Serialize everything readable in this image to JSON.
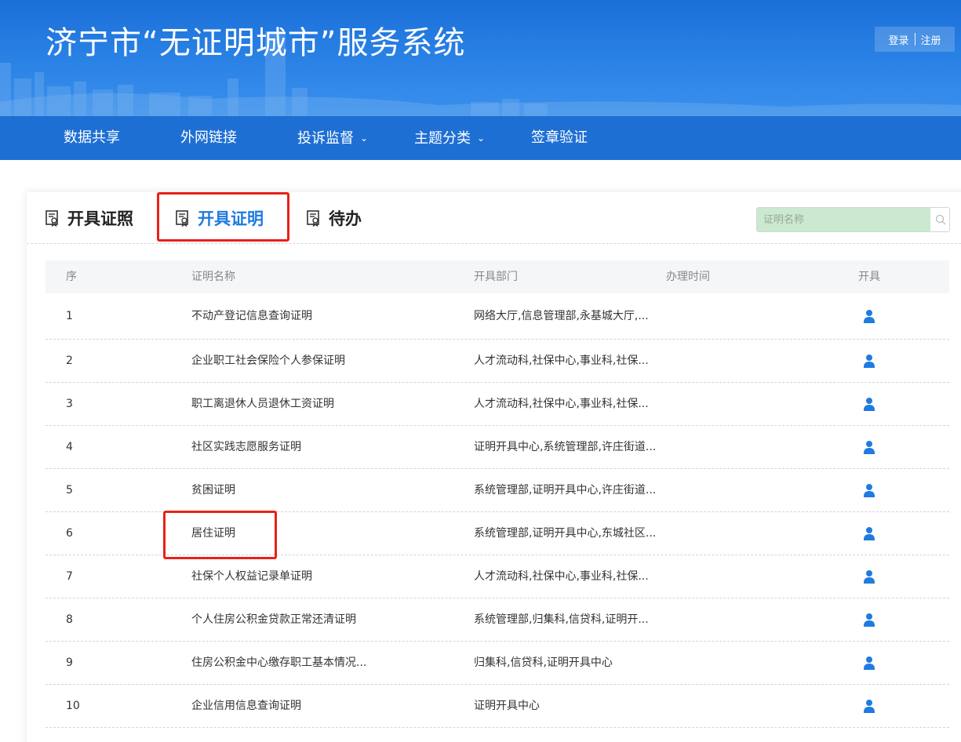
{
  "header": {
    "title": "济宁市“无证明城市”服务系统",
    "login_label": "登录",
    "register_label": "注册"
  },
  "nav": {
    "items": [
      {
        "label": "数据共享",
        "has_dropdown": false
      },
      {
        "label": "外网链接",
        "has_dropdown": false
      },
      {
        "label": "投诉监督",
        "has_dropdown": true
      },
      {
        "label": "主题分类",
        "has_dropdown": true
      },
      {
        "label": "签章验证",
        "has_dropdown": false
      }
    ]
  },
  "tabs": [
    {
      "label": "开具证照",
      "active": false
    },
    {
      "label": "开具证明",
      "active": true
    },
    {
      "label": "待办",
      "active": false
    }
  ],
  "search": {
    "placeholder": "证明名称",
    "value": ""
  },
  "table": {
    "columns": [
      "序",
      "证明名称",
      "开具部门",
      "办理时间",
      "开具"
    ],
    "rows": [
      {
        "index": "1",
        "name": "不动产登记信息查询证明",
        "department": "网络大厅,信息管理部,永基城大厅,...",
        "time": ""
      },
      {
        "index": "2",
        "name": "企业职工社会保险个人参保证明",
        "department": "人才流动科,社保中心,事业科,社保...",
        "time": ""
      },
      {
        "index": "3",
        "name": "职工离退休人员退休工资证明",
        "department": "人才流动科,社保中心,事业科,社保...",
        "time": ""
      },
      {
        "index": "4",
        "name": "社区实践志愿服务证明",
        "department": "证明开具中心,系统管理部,许庄街道...",
        "time": ""
      },
      {
        "index": "5",
        "name": "贫困证明",
        "department": "系统管理部,证明开具中心,许庄街道...",
        "time": ""
      },
      {
        "index": "6",
        "name": "居住证明",
        "department": "系统管理部,证明开具中心,东城社区...",
        "time": ""
      },
      {
        "index": "7",
        "name": "社保个人权益记录单证明",
        "department": "人才流动科,社保中心,事业科,社保...",
        "time": ""
      },
      {
        "index": "8",
        "name": "个人住房公积金贷款正常还清证明",
        "department": "系统管理部,归集科,信贷科,证明开...",
        "time": ""
      },
      {
        "index": "9",
        "name": "住房公积金中心缴存职工基本情况...",
        "department": "归集科,信贷科,证明开具中心",
        "time": ""
      },
      {
        "index": "10",
        "name": "企业信用信息查询证明",
        "department": "证明开具中心",
        "time": ""
      }
    ]
  },
  "colors": {
    "primary": "#1e6fd4",
    "active_tab": "#1e7be0",
    "highlight": "#e8211a",
    "search_bg": "#cbe9cf"
  },
  "icons": {
    "issue": "user-icon",
    "tab": "certificate-icon",
    "search": "search-icon",
    "dropdown": "chevron-down-icon"
  }
}
